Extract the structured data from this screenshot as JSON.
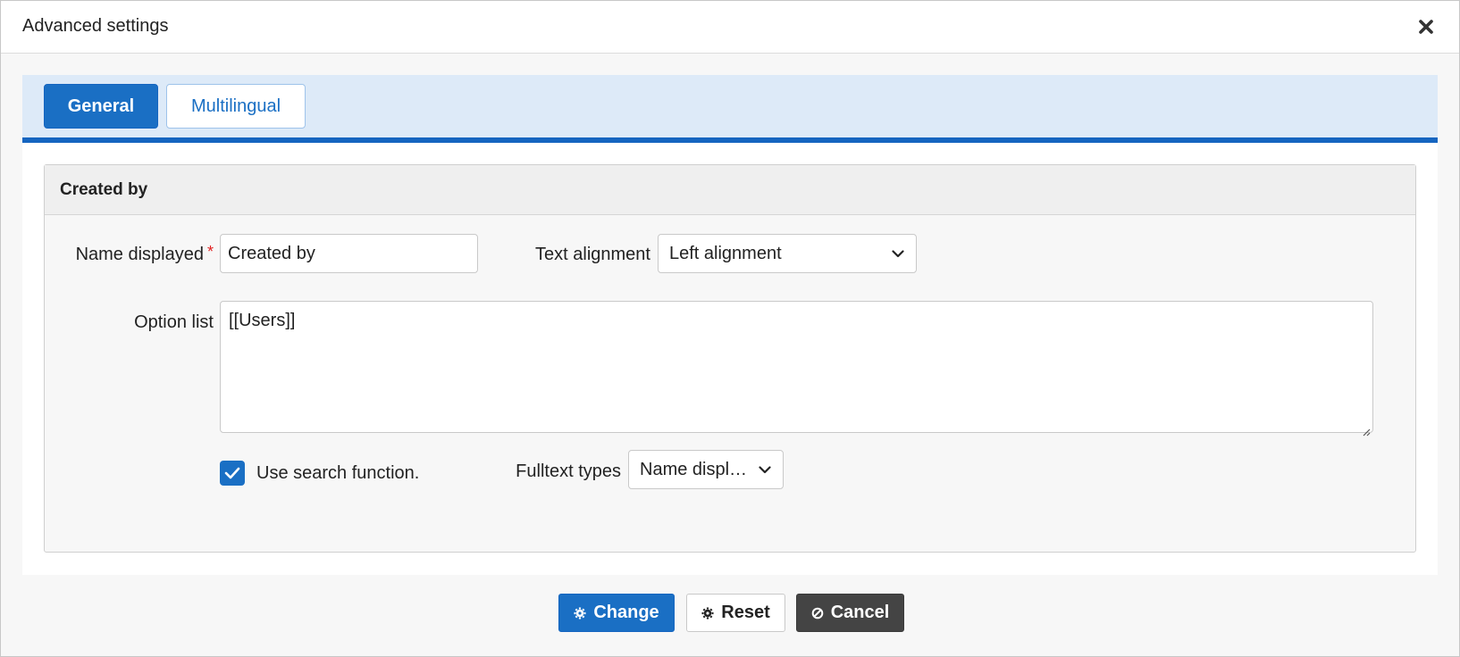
{
  "window": {
    "title": "Advanced settings",
    "close_icon": "close-icon"
  },
  "tabs": [
    {
      "label": "General",
      "active": true
    },
    {
      "label": "Multilingual",
      "active": false
    }
  ],
  "panel": {
    "title": "Created by",
    "name_displayed": {
      "label": "Name displayed",
      "required_mark": "*",
      "value": "Created by"
    },
    "text_alignment": {
      "label": "Text alignment",
      "selected": "Left alignment"
    },
    "option_list": {
      "label": "Option list",
      "value": "[[Users]]"
    },
    "use_search": {
      "label": "Use search function.",
      "checked": true
    },
    "fulltext_types": {
      "label": "Fulltext types",
      "selected": "Name displ…"
    }
  },
  "buttons": {
    "change": "Change",
    "reset": "Reset",
    "cancel": "Cancel"
  },
  "colors": {
    "accent": "#1a6fc4",
    "tabbar_bg": "#ddeaf8",
    "cancel_bg": "#444444",
    "required": "#e02020"
  }
}
